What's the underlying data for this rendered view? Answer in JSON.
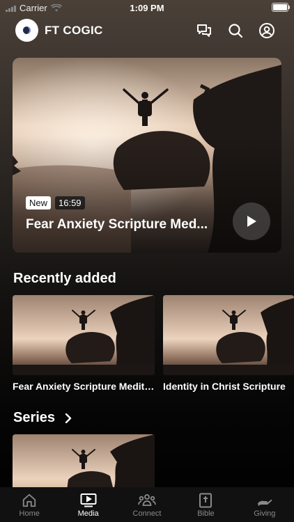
{
  "status_bar": {
    "carrier": "Carrier",
    "time": "1:09 PM"
  },
  "header": {
    "app_name": "FT COGIC"
  },
  "featured": {
    "badge": "New",
    "duration": "16:59",
    "title": "Fear Anxiety Scripture Med..."
  },
  "recently_added": {
    "title": "Recently added",
    "items": [
      {
        "title": "Fear Anxiety Scripture Meditation"
      },
      {
        "title": "Identity in Christ Scripture"
      }
    ]
  },
  "series": {
    "title": "Series"
  },
  "tabs": [
    {
      "label": "Home",
      "icon": "home-icon"
    },
    {
      "label": "Media",
      "icon": "media-icon"
    },
    {
      "label": "Connect",
      "icon": "connect-icon"
    },
    {
      "label": "Bible",
      "icon": "bible-icon"
    },
    {
      "label": "Giving",
      "icon": "giving-icon"
    }
  ],
  "active_tab": "Media",
  "colors": {
    "background": "#000000",
    "tabbar": "#111111",
    "active": "#ffffff",
    "inactive": "#8a8a8a"
  }
}
